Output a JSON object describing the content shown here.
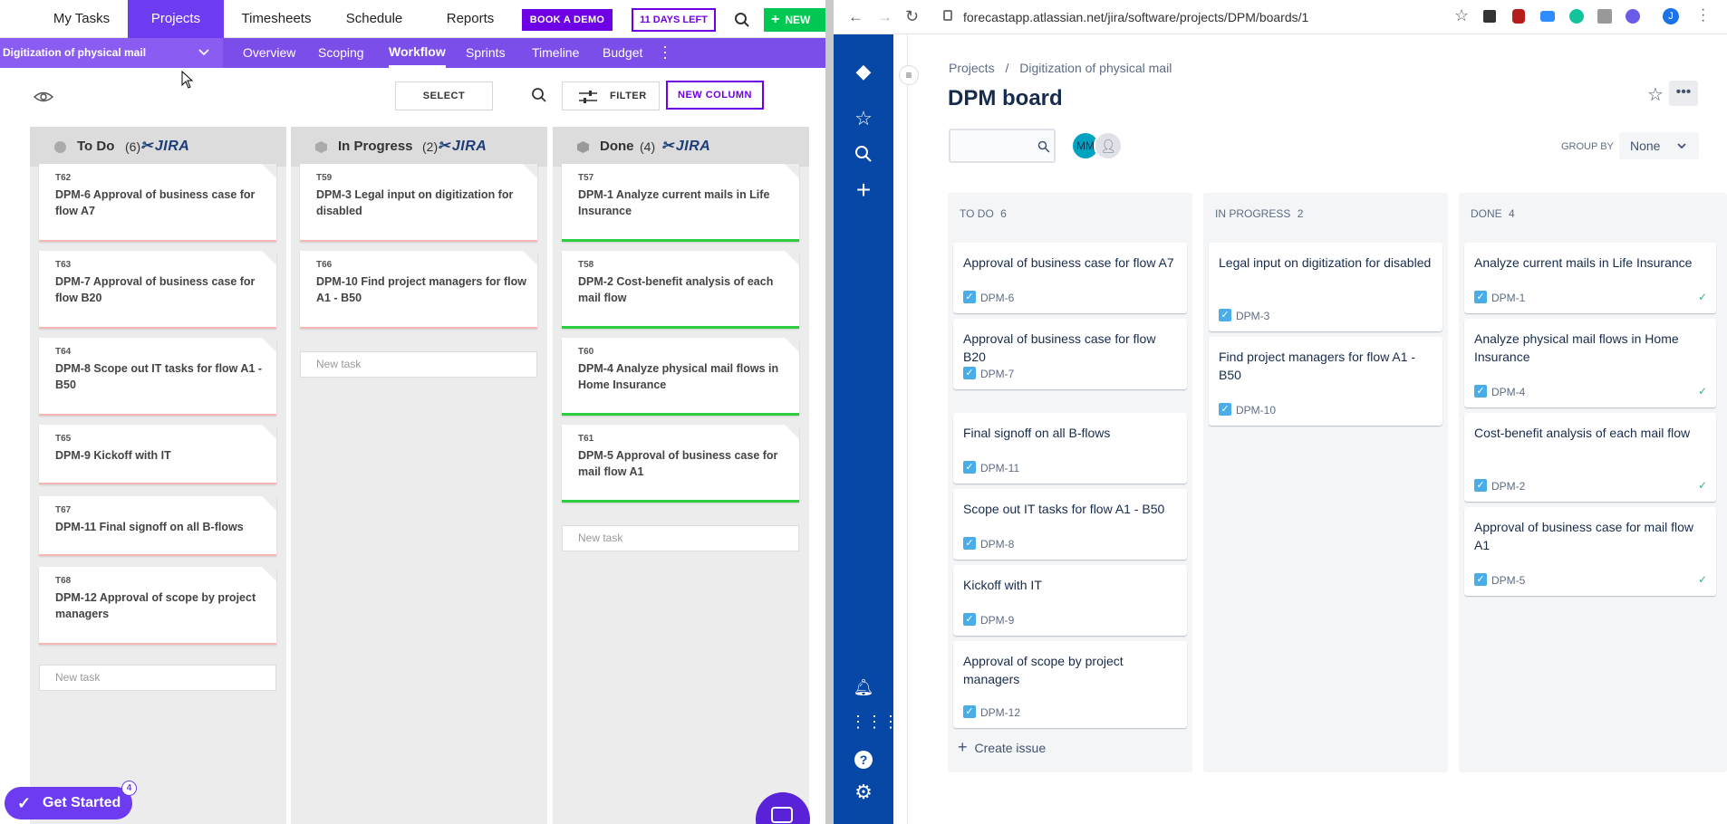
{
  "forecast": {
    "nav": {
      "my_tasks": "My Tasks",
      "projects": "Projects",
      "timesheets": "Timesheets",
      "schedule": "Schedule",
      "reports": "Reports",
      "book_demo": "BOOK A DEMO",
      "days_left": "11 DAYS LEFT",
      "new": "NEW"
    },
    "project_name": "Digitization of physical mail",
    "tabs": [
      "Overview",
      "Scoping",
      "Workflow",
      "Sprints",
      "Timeline",
      "Budget"
    ],
    "active_tab": "Workflow",
    "toolbar": {
      "select": "SELECT",
      "filter": "FILTER",
      "new_column": "NEW COLUMN"
    },
    "jira_label": "JIRA",
    "new_task": "New task",
    "columns": [
      {
        "name": "To Do",
        "count": "(6)",
        "cards": [
          {
            "id": "T62",
            "title": "DPM-6 Approval of business case for flow A7"
          },
          {
            "id": "T63",
            "title": "DPM-7 Approval of business case for flow B20"
          },
          {
            "id": "T64",
            "title": "DPM-8 Scope out IT tasks for flow A1 - B50"
          },
          {
            "id": "T65",
            "title": "DPM-9 Kickoff with IT"
          },
          {
            "id": "T67",
            "title": "DPM-11 Final signoff on all B-flows"
          },
          {
            "id": "T68",
            "title": "DPM-12 Approval of scope by project managers"
          }
        ]
      },
      {
        "name": "In Progress",
        "count": "(2)",
        "cards": [
          {
            "id": "T59",
            "title": "DPM-3 Legal input on digitization for disabled"
          },
          {
            "id": "T66",
            "title": "DPM-10 Find project managers for flow A1 - B50"
          }
        ]
      },
      {
        "name": "Done",
        "count": "(4)",
        "cards": [
          {
            "id": "T57",
            "title": "DPM-1 Analyze current mails in Life Insurance"
          },
          {
            "id": "T58",
            "title": "DPM-2 Cost-benefit analysis of each mail flow"
          },
          {
            "id": "T60",
            "title": "DPM-4 Analyze physical mail flows in Home Insurance"
          },
          {
            "id": "T61",
            "title": "DPM-5 Approval of business case for mail flow A1"
          }
        ]
      }
    ],
    "get_started": "Get Started",
    "get_started_badge": "4",
    "colors": {
      "purple": "#6e00e6",
      "green": "#00c853",
      "todo_bar": "#f5b7b1",
      "done_bar": "#2ecc40"
    }
  },
  "browser": {
    "url": "forecastapp.atlassian.net/jira/software/projects/DPM/boards/1"
  },
  "jira": {
    "breadcrumb_projects": "Projects",
    "breadcrumb_sep": "/",
    "breadcrumb_project": "Digitization of physical mail",
    "board_title": "DPM board",
    "avatar_initials": "MM",
    "group_by_label": "GROUP BY",
    "group_by_value": "None",
    "create_issue": "Create issue",
    "columns": [
      {
        "name": "TO DO",
        "count": "6",
        "issues": [
          {
            "title": "Approval of business case for flow A7",
            "key": "DPM-6"
          },
          {
            "title": "Approval of business case for flow B20",
            "key": "DPM-7"
          },
          {
            "title": "Final signoff on all B-flows",
            "key": "DPM-11"
          },
          {
            "title": "Scope out IT tasks for flow A1 - B50",
            "key": "DPM-8"
          },
          {
            "title": "Kickoff with IT",
            "key": "DPM-9"
          },
          {
            "title": "Approval of scope by project managers",
            "key": "DPM-12"
          }
        ]
      },
      {
        "name": "IN PROGRESS",
        "count": "2",
        "issues": [
          {
            "title": "Legal input on digitization for disabled",
            "key": "DPM-3"
          },
          {
            "title": "Find project managers for flow A1 - B50",
            "key": "DPM-10"
          }
        ]
      },
      {
        "name": "DONE",
        "count": "4",
        "issues": [
          {
            "title": "Analyze current mails in Life Insurance",
            "key": "DPM-1"
          },
          {
            "title": "Analyze physical mail flows in Home Insurance",
            "key": "DPM-4"
          },
          {
            "title": "Cost-benefit analysis of each mail flow",
            "key": "DPM-2"
          },
          {
            "title": "Approval of business case for mail flow A1",
            "key": "DPM-5"
          }
        ]
      }
    ],
    "colors": {
      "sidebar": "#0747a6",
      "checkbox": "#4bade8",
      "done_check": "#36b37e"
    }
  }
}
